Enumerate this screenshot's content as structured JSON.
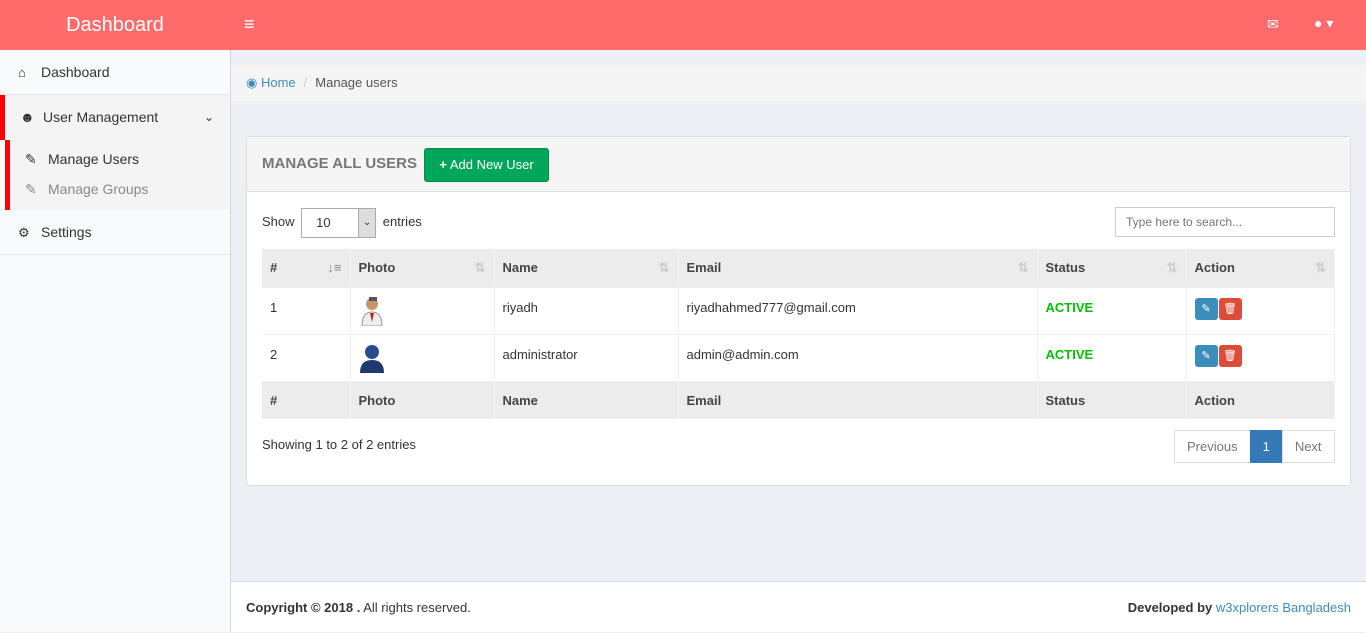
{
  "header": {
    "logo": "Dashboard",
    "menu_icon": "≡",
    "mail_icon": "✉",
    "user_icon": "▾"
  },
  "sidebar": {
    "dashboard": "Dashboard",
    "user_management": "User Management",
    "manage_users": "Manage Users",
    "manage_groups": "Manage Groups",
    "settings": "Settings"
  },
  "breadcrumb": {
    "home": "Home",
    "current": "Manage users"
  },
  "box": {
    "title": "MANAGE ALL USERS",
    "add_button": "Add New User",
    "show": "Show",
    "entries_value": "10",
    "entries": "entries",
    "search_placeholder": "Type here to search..."
  },
  "table": {
    "columns": [
      "#",
      "Photo",
      "Name",
      "Email",
      "Status",
      "Action"
    ],
    "rows": [
      {
        "id": "1",
        "name": "riyadh",
        "email": "riyadhahmed777@gmail.com",
        "status": "ACTIVE"
      },
      {
        "id": "2",
        "name": "administrator",
        "email": "admin@admin.com",
        "status": "ACTIVE"
      }
    ]
  },
  "info": "Showing 1 to 2 of 2 entries",
  "pagination": {
    "previous": "Previous",
    "page": "1",
    "next": "Next"
  },
  "footer": {
    "copyright": "Copyright © 2018 .",
    "rights": " All rights reserved.",
    "developed": "Developed by ",
    "company": "w3xplorers Bangladesh"
  },
  "colors": {
    "header": "#ff6b6b",
    "active": "#00c000",
    "accent": "#3c8dbc",
    "add": "#00a65a",
    "danger": "#dd4b39"
  }
}
